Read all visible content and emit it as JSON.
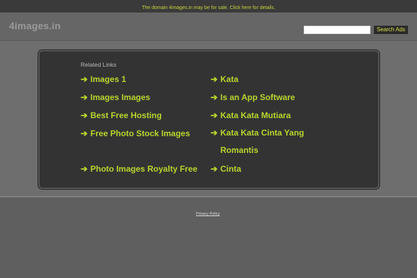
{
  "topbar": {
    "notice": "The domain 4images.in may be for sale. Click here for details."
  },
  "header": {
    "logo": "4images.in",
    "search_placeholder": "",
    "search_button": "Search Ads"
  },
  "related": {
    "title": "Related Links",
    "arrow": "➔",
    "left": [
      "Images 1",
      "Images Images",
      "Best Free Hosting",
      "Free Photo Stock Images",
      "Photo Images Royalty Free"
    ],
    "right": [
      "Kata",
      "Is an App Software",
      "Kata Kata Mutiara",
      "Kata Kata Cinta Yang Romantis",
      "Cinta"
    ]
  },
  "footer": {
    "privacy": "Privacy Policy"
  },
  "colors": {
    "accent": "#b7d62e",
    "topbar_text": "#c6d23a"
  }
}
